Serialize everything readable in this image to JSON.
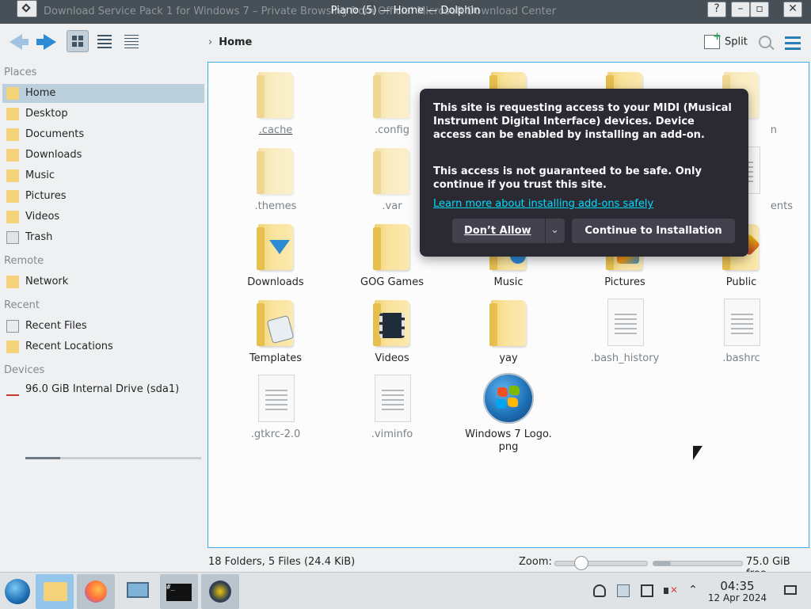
{
  "window": {
    "title": "Piano (5) — Home — Dolphin",
    "background_title": "Download Service Pack 1 for Windows 7 – Private Browsing from Official Microsoft Download Center"
  },
  "toolbar": {
    "breadcrumb": "Home",
    "split_label": "Split"
  },
  "sidebar": {
    "places_title": "Places",
    "places": [
      {
        "label": "Home",
        "icon": "home-icon",
        "active": true
      },
      {
        "label": "Desktop",
        "icon": "desktop-icon"
      },
      {
        "label": "Documents",
        "icon": "documents-icon"
      },
      {
        "label": "Downloads",
        "icon": "downloads-icon"
      },
      {
        "label": "Music",
        "icon": "music-icon"
      },
      {
        "label": "Pictures",
        "icon": "pictures-icon"
      },
      {
        "label": "Videos",
        "icon": "videos-icon"
      },
      {
        "label": "Trash",
        "icon": "trash-icon"
      }
    ],
    "remote_title": "Remote",
    "remote": [
      {
        "label": "Network",
        "icon": "network-icon"
      }
    ],
    "recent_title": "Recent",
    "recent": [
      {
        "label": "Recent Files",
        "icon": "recent-files-icon"
      },
      {
        "label": "Recent Locations",
        "icon": "recent-locations-icon"
      }
    ],
    "devices_title": "Devices",
    "devices": [
      {
        "label": "96.0 GiB Internal Drive (sda1)",
        "icon": "drive-icon",
        "used_fraction": 0.2
      }
    ]
  },
  "files": [
    {
      "name": ".cache",
      "type": "folder",
      "hidden": true
    },
    {
      "name": ".config",
      "type": "folder",
      "hidden": true
    },
    {
      "name": ".themes",
      "type": "folder",
      "hidden": true
    },
    {
      "name": ".var",
      "type": "folder",
      "hidden": true
    },
    {
      "name": "Downloads",
      "type": "folder",
      "emblem": "download"
    },
    {
      "name": "GOG Games",
      "type": "folder"
    },
    {
      "name": "Music",
      "type": "folder"
    },
    {
      "name": "Pictures",
      "type": "folder"
    },
    {
      "name": "Public",
      "type": "folder"
    },
    {
      "name": "Templates",
      "type": "folder",
      "emblem": "templates"
    },
    {
      "name": "Videos",
      "type": "folder",
      "emblem": "videos"
    },
    {
      "name": "yay",
      "type": "folder"
    },
    {
      "name": ".bash_history",
      "type": "text",
      "hidden": true
    },
    {
      "name": ".bashrc",
      "type": "text",
      "hidden": true
    },
    {
      "name": ".gtkrc-2.0",
      "type": "text",
      "hidden": true
    },
    {
      "name": ".viminfo",
      "type": "text",
      "hidden": true
    },
    {
      "name": "Windows 7 Logo.",
      "name2": "png",
      "type": "image"
    },
    {
      "name": "ents",
      "type": "partial"
    },
    {
      "name": "n",
      "type": "partial"
    }
  ],
  "popup": {
    "message": "This site is requesting access to your MIDI (Musical Instrument Digital Interface) devices. Device access can be enabled by installing an add-on.",
    "warning": "This access is not guaranteed to be safe. Only continue if you trust this site.",
    "learn_more": "Learn more about installing add-ons safely",
    "dont_allow": "Don’t Allow",
    "continue": "Continue to Installation"
  },
  "status": {
    "info": "18 Folders, 5 Files (24.4 KiB)",
    "zoom_label": "Zoom:",
    "zoom_fraction": 0.28,
    "free_label": "75.0 GiB free",
    "free_used_fraction": 0.2
  },
  "taskbar": {
    "time": "04:35",
    "date": "12 Apr 2024"
  },
  "colors": {
    "accent": "#3daee9",
    "popup_bg": "#2b2a33",
    "popup_link": "#00ddff",
    "folder": "#f9e39c"
  }
}
